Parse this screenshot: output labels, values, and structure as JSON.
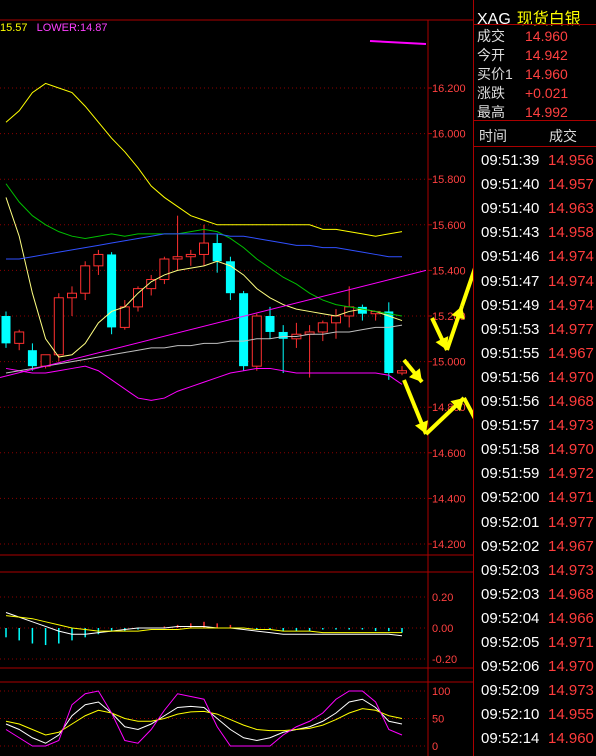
{
  "indicator_bar": {
    "mid_value": "15.57",
    "lower_label": "LOWER:14.87"
  },
  "symbol": {
    "code": "XAG",
    "name": "现货白银"
  },
  "quote": [
    {
      "label": "成交",
      "value": "14.960"
    },
    {
      "label": "今开",
      "value": "14.942"
    },
    {
      "label": "买价1",
      "value": "14.960"
    },
    {
      "label": "涨跌",
      "value": "+0.021"
    },
    {
      "label": "最高",
      "value": "14.992"
    }
  ],
  "ticks_header": {
    "time": "时间",
    "price": "成交"
  },
  "ticks": [
    {
      "time": "09:51:39",
      "price": "14.956"
    },
    {
      "time": "09:51:40",
      "price": "14.957"
    },
    {
      "time": "09:51:40",
      "price": "14.963"
    },
    {
      "time": "09:51:43",
      "price": "14.958"
    },
    {
      "time": "09:51:46",
      "price": "14.974"
    },
    {
      "time": "09:51:47",
      "price": "14.974"
    },
    {
      "time": "09:51:49",
      "price": "14.974"
    },
    {
      "time": "09:51:53",
      "price": "14.977"
    },
    {
      "time": "09:51:55",
      "price": "14.967"
    },
    {
      "time": "09:51:56",
      "price": "14.970"
    },
    {
      "time": "09:51:56",
      "price": "14.968"
    },
    {
      "time": "09:51:57",
      "price": "14.973"
    },
    {
      "time": "09:51:58",
      "price": "14.970"
    },
    {
      "time": "09:51:59",
      "price": "14.972"
    },
    {
      "time": "09:52:00",
      "price": "14.971"
    },
    {
      "time": "09:52:01",
      "price": "14.977"
    },
    {
      "time": "09:52:02",
      "price": "14.967"
    },
    {
      "time": "09:52:03",
      "price": "14.973"
    },
    {
      "time": "09:52:03",
      "price": "14.968"
    },
    {
      "time": "09:52:04",
      "price": "14.966"
    },
    {
      "time": "09:52:05",
      "price": "14.971"
    },
    {
      "time": "09:52:06",
      "price": "14.970"
    },
    {
      "time": "09:52:09",
      "price": "14.973"
    },
    {
      "time": "09:52:10",
      "price": "14.955"
    },
    {
      "time": "09:52:14",
      "price": "14.960"
    }
  ],
  "main_axis": {
    "ticks": [
      "16.200",
      "16.000",
      "15.800",
      "15.600",
      "15.400",
      "15.200",
      "15.000",
      "14.800",
      "14.600",
      "14.400",
      "14.200"
    ],
    "ylim": [
      14.2,
      16.2
    ]
  },
  "macd_axis": {
    "ticks": [
      "0.20",
      "0.00",
      "-0.20"
    ],
    "ylim": [
      -0.2,
      0.2
    ]
  },
  "kdj_axis": {
    "ticks": [
      "100",
      "50",
      "0"
    ],
    "ylim": [
      0,
      100
    ]
  },
  "colors": {
    "grid": "#8b0000",
    "up": "#ff3030",
    "down": "#00ffff",
    "bb_mid": "#ffff80",
    "bb_upper": "#ffff00",
    "bb_lower": "#ff00ff",
    "ma_green": "#00c000",
    "ma_blue": "#3050ff",
    "ma_gray": "#c0c0c0",
    "arrow": "#ffff00"
  },
  "candles": [
    {
      "o": 15.2,
      "h": 15.22,
      "c": 15.08,
      "l": 15.06
    },
    {
      "o": 15.08,
      "h": 15.14,
      "c": 15.13,
      "l": 15.05
    },
    {
      "o": 15.05,
      "h": 15.08,
      "c": 14.98,
      "l": 14.96
    },
    {
      "o": 14.98,
      "h": 15.03,
      "c": 15.03,
      "l": 14.97
    },
    {
      "o": 15.03,
      "h": 15.3,
      "c": 15.28,
      "l": 15.0
    },
    {
      "o": 15.28,
      "h": 15.33,
      "c": 15.3,
      "l": 15.2
    },
    {
      "o": 15.3,
      "h": 15.44,
      "c": 15.42,
      "l": 15.27
    },
    {
      "o": 15.42,
      "h": 15.49,
      "c": 15.47,
      "l": 15.38
    },
    {
      "o": 15.47,
      "h": 15.48,
      "c": 15.15,
      "l": 15.12
    },
    {
      "o": 15.15,
      "h": 15.27,
      "c": 15.24,
      "l": 15.14
    },
    {
      "o": 15.24,
      "h": 15.33,
      "c": 15.32,
      "l": 15.22
    },
    {
      "o": 15.32,
      "h": 15.38,
      "c": 15.36,
      "l": 15.29
    },
    {
      "o": 15.36,
      "h": 15.46,
      "c": 15.45,
      "l": 15.34
    },
    {
      "o": 15.45,
      "h": 15.64,
      "c": 15.46,
      "l": 15.4
    },
    {
      "o": 15.46,
      "h": 15.49,
      "c": 15.47,
      "l": 15.42
    },
    {
      "o": 15.47,
      "h": 15.6,
      "c": 15.52,
      "l": 15.42
    },
    {
      "o": 15.52,
      "h": 15.56,
      "c": 15.44,
      "l": 15.39
    },
    {
      "o": 15.44,
      "h": 15.46,
      "c": 15.3,
      "l": 15.27
    },
    {
      "o": 15.3,
      "h": 15.31,
      "c": 14.98,
      "l": 14.96
    },
    {
      "o": 14.98,
      "h": 15.21,
      "c": 15.2,
      "l": 14.96
    },
    {
      "o": 15.2,
      "h": 15.24,
      "c": 15.13,
      "l": 15.1
    },
    {
      "o": 15.13,
      "h": 15.16,
      "c": 15.1,
      "l": 14.95
    },
    {
      "o": 15.1,
      "h": 15.17,
      "c": 15.12,
      "l": 15.06
    },
    {
      "o": 15.12,
      "h": 15.16,
      "c": 15.13,
      "l": 14.93
    },
    {
      "o": 15.13,
      "h": 15.18,
      "c": 15.17,
      "l": 15.09
    },
    {
      "o": 15.17,
      "h": 15.23,
      "c": 15.2,
      "l": 15.1
    },
    {
      "o": 15.2,
      "h": 15.33,
      "c": 15.24,
      "l": 15.15
    },
    {
      "o": 15.24,
      "h": 15.25,
      "c": 15.21,
      "l": 15.18
    },
    {
      "o": 15.21,
      "h": 15.22,
      "c": 15.22,
      "l": 15.18
    },
    {
      "o": 15.22,
      "h": 15.26,
      "c": 14.95,
      "l": 14.92
    },
    {
      "o": 14.95,
      "h": 14.98,
      "c": 14.96,
      "l": 14.94
    }
  ]
}
